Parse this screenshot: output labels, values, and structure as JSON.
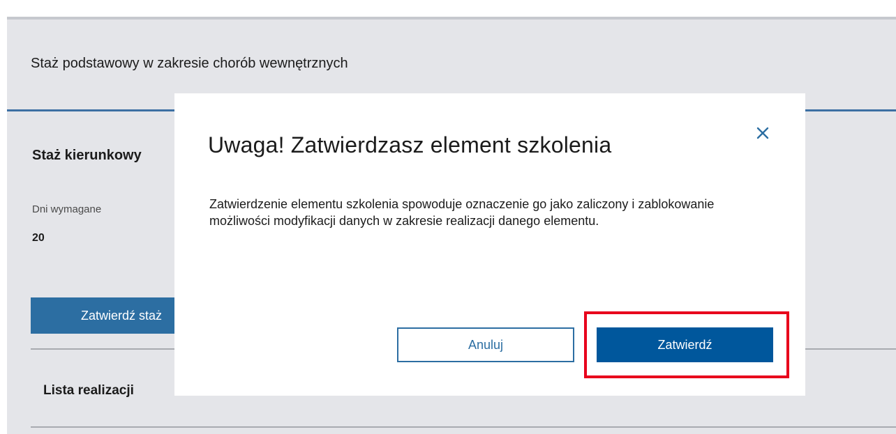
{
  "background": {
    "section_title": "Staż podstawowy w zakresie chorób wewnętrznych",
    "subsection_title": "Staż kierunkowy",
    "days_required_label": "Dni wymagane",
    "days_required_value": "20",
    "approve_button_label": "Zatwierdź staż",
    "list_title": "Lista realizacji"
  },
  "modal": {
    "title": "Uwaga! Zatwierdzasz element szkolenia",
    "body": "Zatwierdzenie elementu szkolenia spowoduje oznaczenie go jako zaliczony i zablokowanie możliwości modyfikacji danych w zakresie realizacji danego elementu.",
    "close_icon": "close-icon",
    "cancel_label": "Anuluj",
    "confirm_label": "Zatwierdź"
  },
  "colors": {
    "page_bg": "#e4e5e9",
    "accent_blue": "#00579c",
    "button_blue": "#2c6ea2",
    "highlight_red": "#e8001c"
  }
}
